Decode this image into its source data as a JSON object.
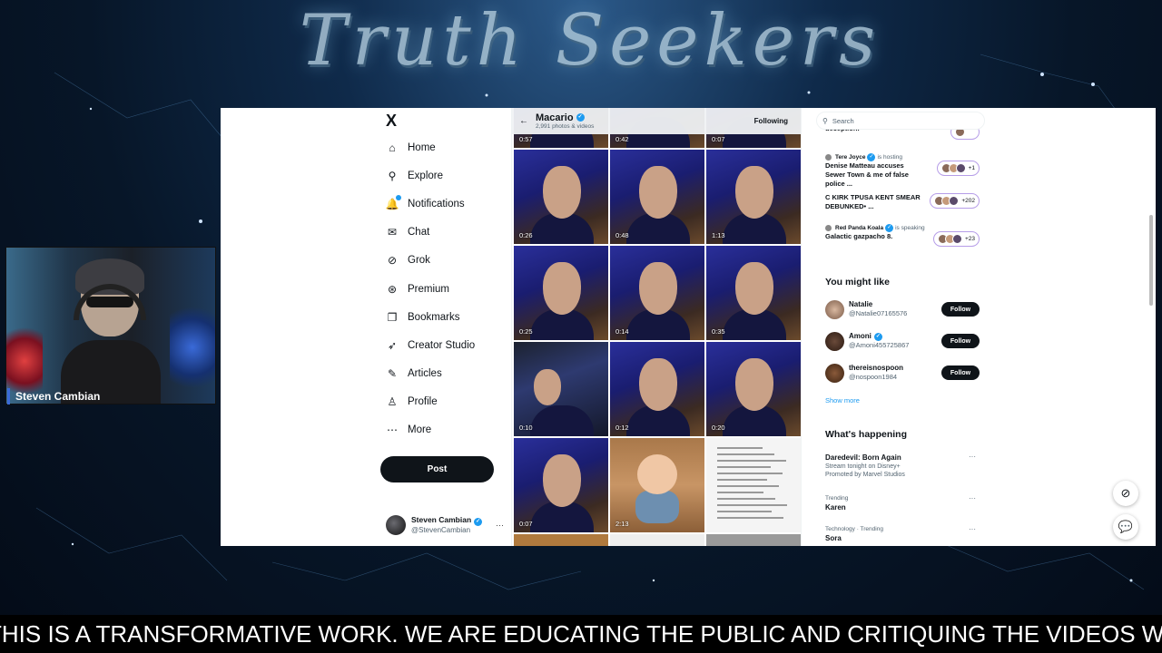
{
  "overlay": {
    "banner_title": "Truth Seekers",
    "cam_label": "Steven Cambian",
    "ticker": "THIS IS A TRANSFORMATIVE WORK. WE ARE EDUCATING THE PUBLIC AND CRITIQUING THE VIDEOS WE"
  },
  "nav": {
    "logo": "X",
    "items": [
      {
        "label": "Home",
        "icon": "home-icon",
        "glyph": "⌂"
      },
      {
        "label": "Explore",
        "icon": "search-icon",
        "glyph": "⚲"
      },
      {
        "label": "Notifications",
        "icon": "bell-icon",
        "glyph": "🔔"
      },
      {
        "label": "Chat",
        "icon": "mail-icon",
        "glyph": "✉"
      },
      {
        "label": "Grok",
        "icon": "grok-icon",
        "glyph": "⊘"
      },
      {
        "label": "Premium",
        "icon": "premium-icon",
        "glyph": "⊛"
      },
      {
        "label": "Bookmarks",
        "icon": "bookmark-icon",
        "glyph": "❐"
      },
      {
        "label": "Creator Studio",
        "icon": "rocket-icon",
        "glyph": "➶"
      },
      {
        "label": "Articles",
        "icon": "article-icon",
        "glyph": "✎"
      },
      {
        "label": "Profile",
        "icon": "profile-icon",
        "glyph": "♙"
      },
      {
        "label": "More",
        "icon": "more-icon",
        "glyph": "⋯"
      }
    ],
    "post_label": "Post",
    "account": {
      "name": "Steven Cambian",
      "handle": "@StevenCambian",
      "more": "···"
    }
  },
  "profile_header": {
    "name": "Macario",
    "sub": "2,991 photos & videos",
    "following_label": "Following"
  },
  "media": {
    "top_durations": [
      "0:57",
      "0:42",
      "0:07"
    ],
    "tiles": [
      {
        "duration": "0:26",
        "kind": "face"
      },
      {
        "duration": "0:48",
        "kind": "face"
      },
      {
        "duration": "1:13",
        "kind": "face"
      },
      {
        "duration": "0:25",
        "kind": "face"
      },
      {
        "duration": "0:14",
        "kind": "face"
      },
      {
        "duration": "0:35",
        "kind": "face"
      },
      {
        "duration": "0:10",
        "kind": "studio"
      },
      {
        "duration": "0:12",
        "kind": "face"
      },
      {
        "duration": "0:20",
        "kind": "face"
      },
      {
        "duration": "0:07",
        "kind": "face"
      },
      {
        "duration": "2:13",
        "kind": "baby"
      },
      {
        "duration": "",
        "kind": "doc"
      }
    ]
  },
  "sidebar": {
    "search_placeholder": "Search",
    "spaces": [
      {
        "host": "",
        "status": "",
        "title": "deception!",
        "listeners": ""
      },
      {
        "host": "Tere Joyce",
        "status": "is hosting",
        "title": "Denise Matteau accuses Sewer Town & me of false police ...",
        "listeners": "+1"
      },
      {
        "host": "",
        "status": "",
        "title": "C KIRK TPUSA KENT SMEAR DEBUNKED• ...",
        "listeners": "+202"
      },
      {
        "host": "Red Panda Koala",
        "status": "is speaking",
        "title": "Galactic gazpacho 8.",
        "listeners": "+23"
      }
    ],
    "you_might_like_title": "You might like",
    "suggestions": [
      {
        "name": "Natalie",
        "handle": "@Natalie07165576",
        "verified": false,
        "button": "Follow"
      },
      {
        "name": "Amoni",
        "handle": "@Amoni455725867",
        "verified": true,
        "button": "Follow"
      },
      {
        "name": "thereisnospoon",
        "handle": "@nospoon1984",
        "verified": false,
        "button": "Follow"
      }
    ],
    "show_more": "Show more",
    "whats_happening_title": "What's happening",
    "trends": [
      {
        "meta": "",
        "topic": "Daredevil: Born Again",
        "desc": "Stream tonight on Disney+",
        "promo": "Promoted by Marvel Studios"
      },
      {
        "meta": "Trending",
        "topic": "Karen",
        "desc": "",
        "promo": ""
      },
      {
        "meta": "Technology · Trending",
        "topic": "Sora",
        "desc": "",
        "promo": ""
      }
    ],
    "more_glyph": "···"
  },
  "floating": {
    "grok_glyph": "⊘",
    "chat_glyph": "💬"
  },
  "colors": {
    "accent": "#1d9bf0",
    "text": "#0f1419",
    "muted": "#536471",
    "ticker_bg": "#000000"
  }
}
